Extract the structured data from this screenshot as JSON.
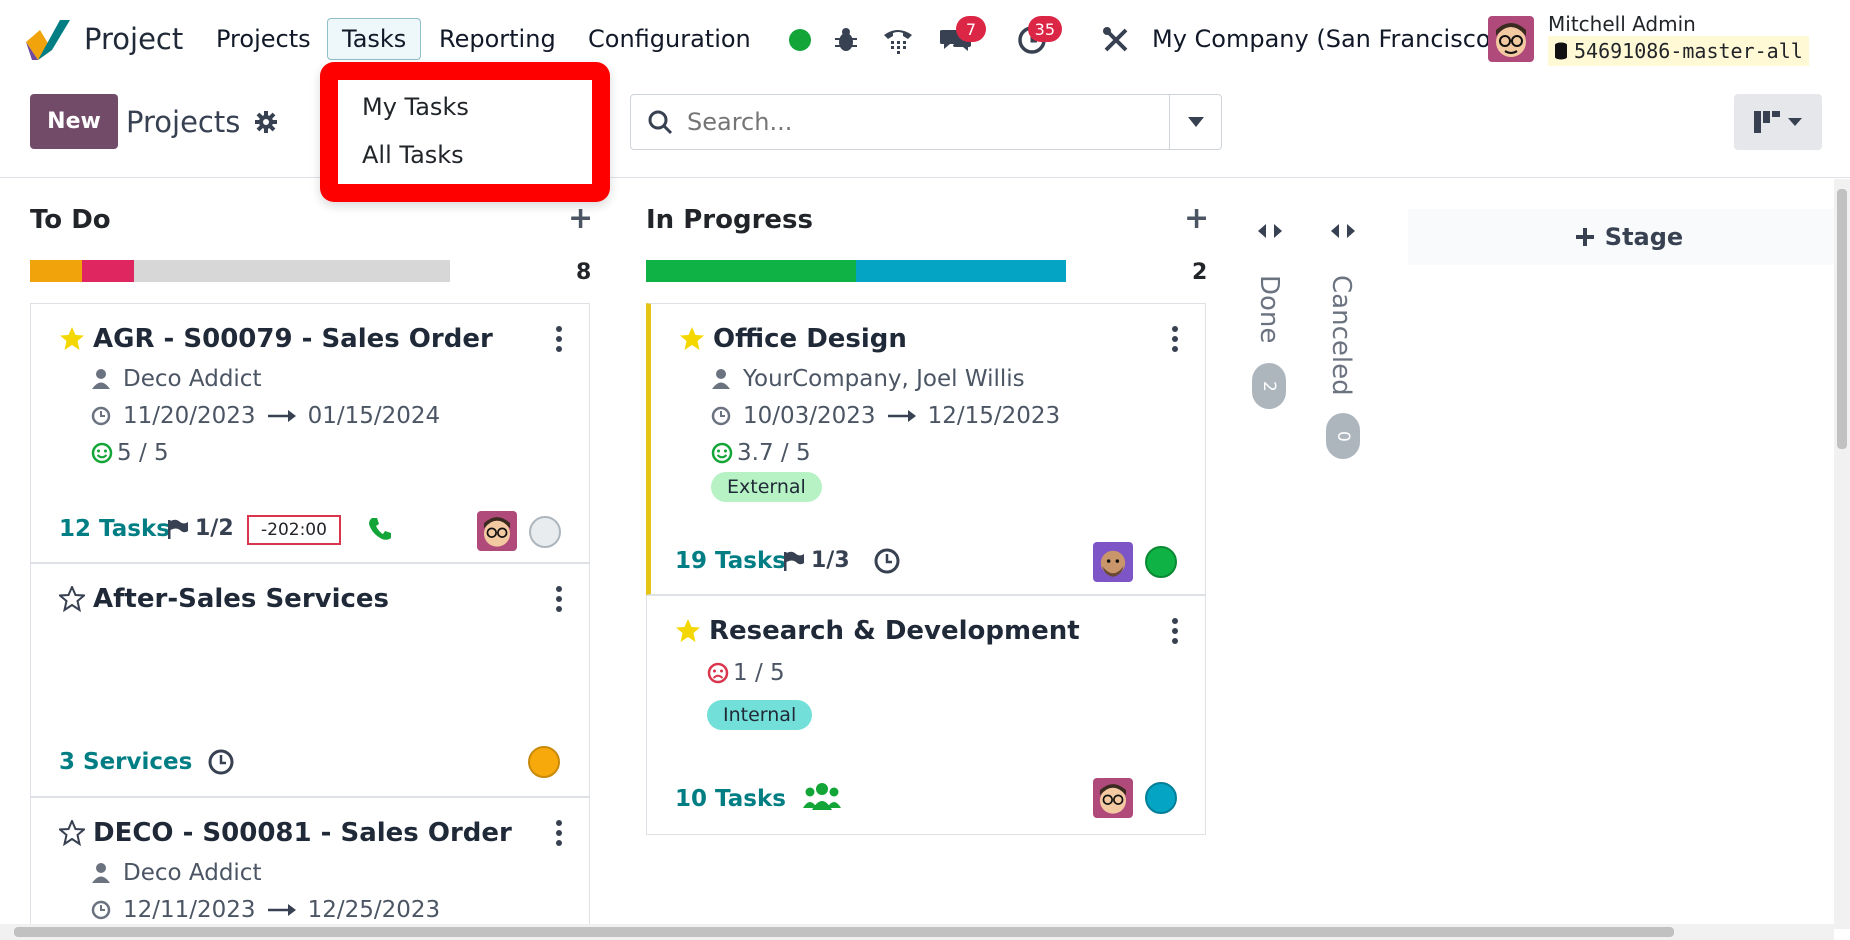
{
  "navbar": {
    "app_title": "Project",
    "menus": [
      "Projects",
      "Tasks",
      "Reporting",
      "Configuration"
    ],
    "chat_badge": "7",
    "activity_badge": "35",
    "company": "My Company (San Francisco)",
    "user_name": "Mitchell Admin",
    "db_name": "54691086-master-all"
  },
  "control": {
    "new_label": "New",
    "breadcrumb": "Projects",
    "search_placeholder": "Search..."
  },
  "tasks_menu": {
    "items": [
      "My Tasks",
      "All Tasks"
    ]
  },
  "columns": {
    "todo": {
      "title": "To Do",
      "count": "8",
      "cards": [
        {
          "title": "AGR - S00079 - Sales Order",
          "customer": "Deco Addict",
          "start": "11/20/2023",
          "end": "01/15/2024",
          "rating": "5 / 5",
          "tasks": "12 Tasks",
          "milestones": "1/2",
          "timesheet": "-202:00"
        },
        {
          "title": "After-Sales Services",
          "tasks": "3 Services"
        },
        {
          "title": "DECO - S00081 - Sales Order",
          "customer": "Deco Addict",
          "start": "12/11/2023",
          "end": "12/25/2023"
        }
      ]
    },
    "inprogress": {
      "title": "In Progress",
      "count": "2",
      "cards": [
        {
          "title": "Office Design",
          "customer": "YourCompany, Joel Willis",
          "start": "10/03/2023",
          "end": "12/15/2023",
          "rating": "3.7 / 5",
          "tag": "External",
          "tasks": "19 Tasks",
          "milestones": "1/3"
        },
        {
          "title": "Research & Development",
          "rating": "1 / 5",
          "tag": "Internal",
          "tasks": "10 Tasks"
        }
      ]
    },
    "done": {
      "title": "Done",
      "count": "2"
    },
    "canceled": {
      "title": "Canceled",
      "count": "0"
    },
    "add_stage": "Stage"
  },
  "colors": {
    "brand": "#714b67",
    "teal": "#017e84",
    "highlight": "#ff0000",
    "todo_progress": [
      "#f0a30a",
      "#e02660",
      "#d7d7d7"
    ],
    "inprogress_progress": [
      "#0fb244",
      "#03a4c4"
    ]
  }
}
